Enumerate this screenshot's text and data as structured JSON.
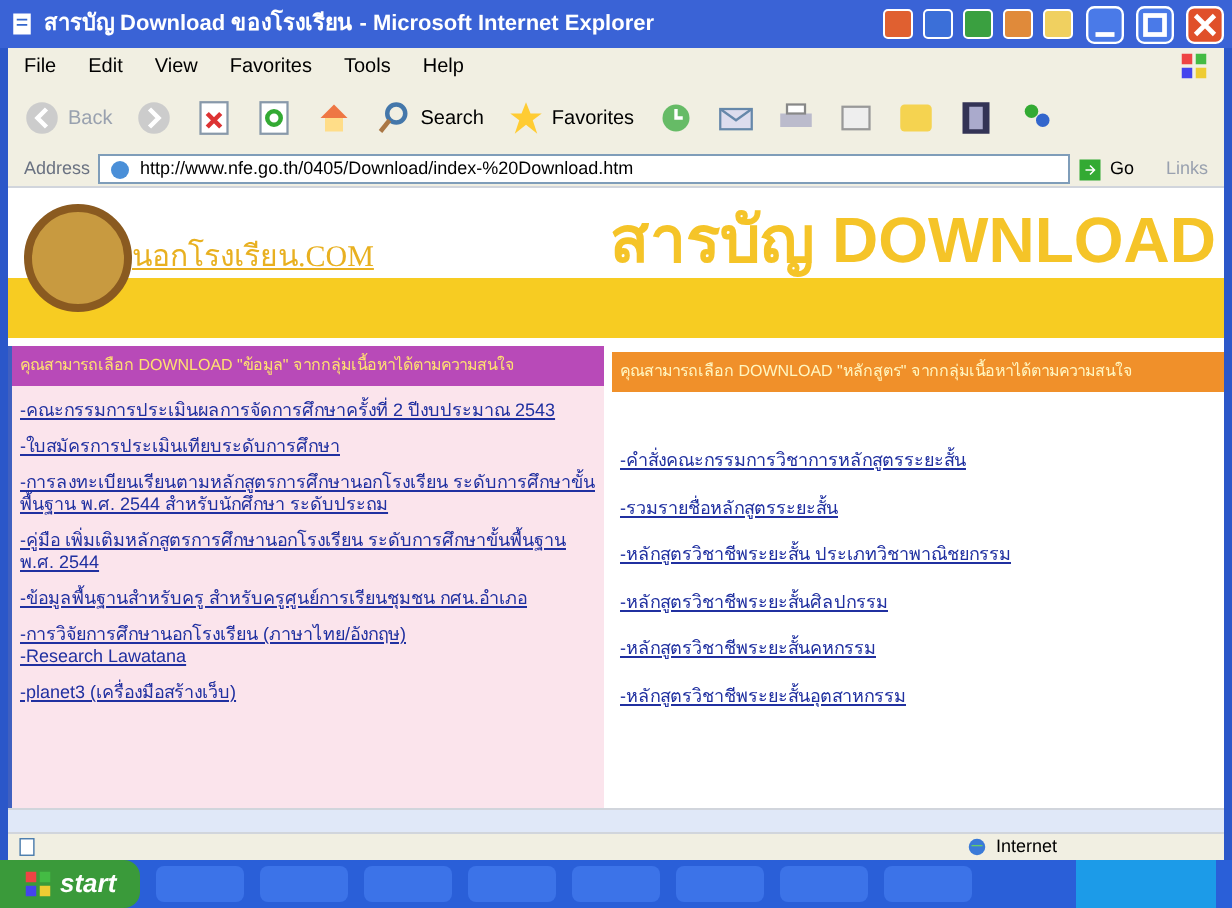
{
  "window": {
    "title": "สารบัญ Download ของโรงเรียน - Microsoft Internet Explorer"
  },
  "menu": [
    "File",
    "Edit",
    "View",
    "Favorites",
    "Tools",
    "Help"
  ],
  "toolbar": {
    "back": "Back",
    "search": "Search",
    "favorites": "Favorites"
  },
  "address_bar": {
    "label": "Address",
    "url": "http://www.nfe.go.th/0405/Download/index-%20Download.htm",
    "go": "Go",
    "links": "Links"
  },
  "page": {
    "heading": "สารบัญ DOWNLOAD",
    "site_name": "นอกโรงเรียน.COM",
    "left": {
      "header": "คุณสามารถเลือก DOWNLOAD \"ข้อมูล\" จากกลุ่มเนื้อหาได้ตามความสนใจ",
      "links": [
        [
          "-คณะกรรมการประเมินผลการจัดการศึกษาครั้งที่ 2 ปีงบประมาณ 2543"
        ],
        [
          "-ใบสมัครการประเมินเทียบระดับการศึกษา"
        ],
        [
          "-การลงทะเบียนเรียนตามหลักสูตรการศึกษานอกโรงเรียน ระดับการศึกษาขั้นพื้นฐาน พ.ศ. 2544 สำหรับนักศึกษา ระดับประถม"
        ],
        [
          "-คู่มือ เพิ่มเติมหลักสูตรการศึกษานอกโรงเรียน ระดับการศึกษาขั้นพื้นฐาน พ.ศ. 2544"
        ],
        [
          "-ข้อมูลพื้นฐานสำหรับครู สำหรับครูศูนย์การเรียนชุมชน กศน.อำเภอ"
        ],
        [
          "-การวิจัยการศึกษานอกโรงเรียน (ภาษาไทย/อังกฤษ)",
          "-Research Lawatana"
        ],
        [
          "-planet3 (เครื่องมือสร้างเว็บ)"
        ]
      ]
    },
    "right": {
      "header": "คุณสามารถเลือก DOWNLOAD \"หลักสูตร\" จากกลุ่มเนื้อหาได้ตามความสนใจ",
      "links": [
        "-คำสั่งคณะกรรมการวิชาการหลักสูตรระยะสั้น",
        "-รวมรายชื่อหลักสูตรระยะสั้น",
        "-หลักสูตรวิชาชีพระยะสั้น ประเภทวิชาพาณิชยกรรม",
        "-หลักสูตรวิชาชีพระยะสั้นศิลปกรรม",
        "-หลักสูตรวิชาชีพระยะสั้นคหกรรม",
        "-หลักสูตรวิชาชีพระยะสั้นอุตสาหกรรม"
      ]
    }
  },
  "status_bar": {
    "zone": "Internet"
  },
  "taskbar": {
    "start": "start"
  }
}
